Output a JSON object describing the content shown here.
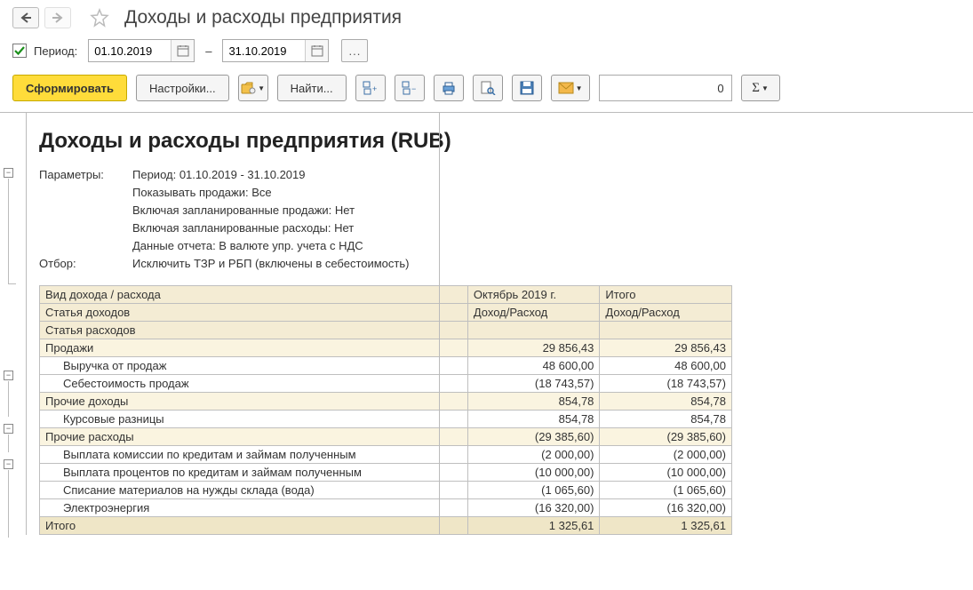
{
  "header": {
    "title": "Доходы и расходы предприятия"
  },
  "period": {
    "label": "Период:",
    "checked": true,
    "from": "01.10.2019",
    "to": "31.10.2019",
    "dash": "–"
  },
  "toolbar": {
    "generate": "Сформировать",
    "settings": "Настройки...",
    "find": "Найти...",
    "num_value": "0"
  },
  "report": {
    "title": "Доходы и расходы предприятия (RUB)",
    "params_label": "Параметры:",
    "filter_label": "Отбор:",
    "params_lines": [
      "Период: 01.10.2019 - 31.10.2019",
      "Показывать продажи: Все",
      "Включая запланированные продажи: Нет",
      "Включая запланированные расходы: Нет",
      "Данные отчета: В валюте упр. учета с НДС"
    ],
    "filter_line": "Исключить ТЗР и РБП (включены в себестоимость)",
    "headers": {
      "h1": "Вид дохода / расхода",
      "h2": "Статья доходов",
      "h3": "Статья расходов",
      "col_period": "Октябрь 2019 г.",
      "col_total": "Итого",
      "col_sub": "Доход/Расход"
    },
    "rows": [
      {
        "type": "grp",
        "name": "Продажи",
        "v1": "29 856,43",
        "v2": "29 856,43"
      },
      {
        "type": "row",
        "name": "Выручка от продаж",
        "indent": 1,
        "v1": "48 600,00",
        "v2": "48 600,00"
      },
      {
        "type": "row",
        "name": "Себестоимость продаж",
        "indent": 1,
        "v1": "(18 743,57)",
        "v2": "(18 743,57)"
      },
      {
        "type": "grp",
        "name": "Прочие доходы",
        "v1": "854,78",
        "v2": "854,78"
      },
      {
        "type": "row",
        "name": "Курсовые разницы",
        "indent": 1,
        "v1": "854,78",
        "v2": "854,78"
      },
      {
        "type": "grp",
        "name": "Прочие расходы",
        "v1": "(29 385,60)",
        "v2": "(29 385,60)"
      },
      {
        "type": "row",
        "name": "Выплата комиссии по кредитам и займам полученным",
        "indent": 1,
        "v1": "(2 000,00)",
        "v2": "(2 000,00)"
      },
      {
        "type": "row",
        "name": "Выплата процентов по кредитам и займам полученным",
        "indent": 1,
        "v1": "(10 000,00)",
        "v2": "(10 000,00)"
      },
      {
        "type": "row",
        "name": "Списание материалов на нужды склада (вода)",
        "indent": 1,
        "v1": "(1 065,60)",
        "v2": "(1 065,60)"
      },
      {
        "type": "row",
        "name": "Электроэнергия",
        "indent": 1,
        "v1": "(16 320,00)",
        "v2": "(16 320,00)"
      },
      {
        "type": "tot",
        "name": "Итого",
        "v1": "1 325,61",
        "v2": "1 325,61"
      }
    ]
  }
}
